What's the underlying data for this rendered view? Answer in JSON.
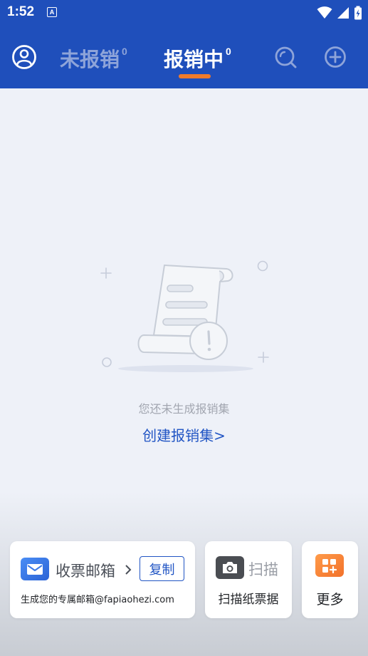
{
  "status_bar": {
    "time": "1:52",
    "app_badge": "A"
  },
  "header": {
    "tabs": [
      {
        "label": "未报销",
        "count": "0"
      },
      {
        "label": "报销中",
        "count": "0"
      }
    ],
    "active_tab": "报销中",
    "icons": [
      "user-icon",
      "search-icon",
      "add-icon"
    ]
  },
  "colors": {
    "header_bg": "#1f4fbb",
    "active_tab": "#ffffff",
    "inactive_tab": "#8ea4d9",
    "indicator": "#f07b2b",
    "link": "#2155c4"
  },
  "empty_state": {
    "message": "您还未生成报销集",
    "action": "创建报销集>"
  },
  "cards": {
    "mail": {
      "title": "收票邮箱",
      "copy_label": "复制",
      "description": "生成您的专属邮箱@fapiaohezi.com"
    },
    "scan": {
      "title": "扫描",
      "description": "扫描纸票据"
    },
    "more": {
      "label": "更多"
    }
  }
}
